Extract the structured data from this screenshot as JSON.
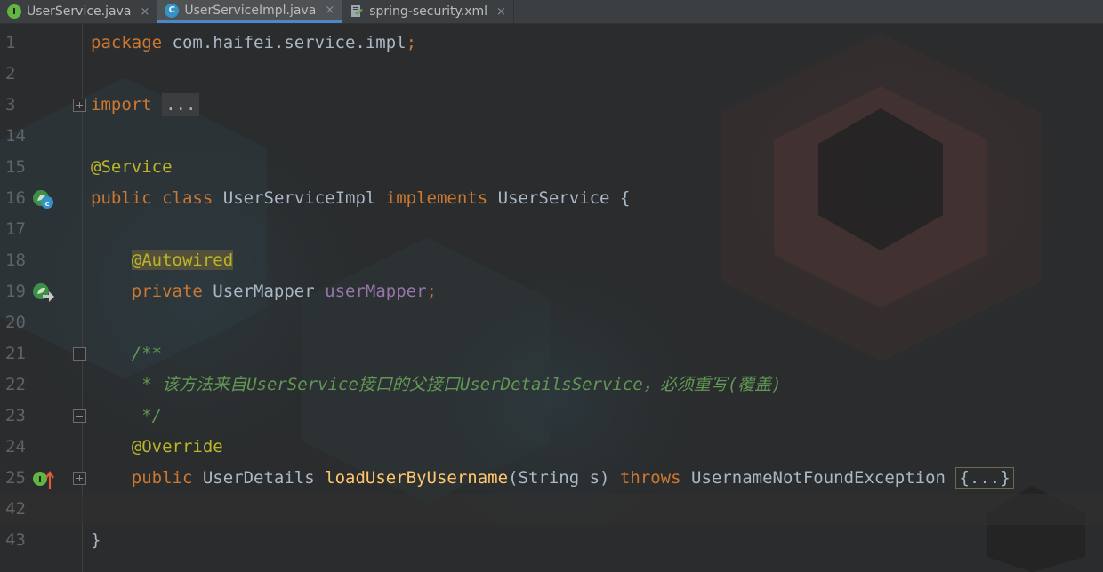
{
  "tabs": [
    {
      "label": "UserService.java",
      "icon": "interface-icon",
      "icon_letter": "I",
      "active": false
    },
    {
      "label": "UserServiceImpl.java",
      "icon": "class-icon",
      "icon_letter": "C",
      "active": true
    },
    {
      "label": "spring-security.xml",
      "icon": "xml-file-icon",
      "icon_letter": "",
      "active": false
    }
  ],
  "close_glyph": "×",
  "editor": {
    "line_numbers": [
      "1",
      "2",
      "3",
      "14",
      "15",
      "16",
      "17",
      "18",
      "19",
      "20",
      "21",
      "22",
      "23",
      "24",
      "25",
      "42",
      "43"
    ],
    "lines": {
      "l1": {
        "kw": "package",
        "rest": " com.haifei.service.impl",
        "semi": ";"
      },
      "l3": {
        "kw": "import",
        "fold": "..."
      },
      "l15": {
        "ann": "@Service"
      },
      "l16": {
        "kw1": "public",
        "kw2": "class",
        "name": "UserServiceImpl",
        "kw3": "implements",
        "iface": "UserService",
        "brace": "{"
      },
      "l18": {
        "ann": "@Autowired"
      },
      "l19": {
        "kw": "private",
        "type": "UserMapper",
        "field": "userMapper",
        "semi": ";"
      },
      "l21": {
        "comment": "/**"
      },
      "l22": {
        "comment": " * 该方法来自UserService接口的父接口UserDetailsService，必须重写(覆盖)"
      },
      "l23": {
        "comment": " */"
      },
      "l24": {
        "ann": "@Override"
      },
      "l25": {
        "kw1": "public",
        "type": "UserDetails",
        "method": "loadUserByUsername",
        "params": "(String s)",
        "kw2": "throws",
        "exc": "UsernameNotFoundException",
        "fold": "{...}"
      },
      "l43": {
        "brace": "}"
      }
    }
  },
  "colors": {
    "keyword": "#cc7832",
    "annotation": "#bbb529",
    "field": "#9876aa",
    "method": "#ffc66d",
    "comment": "#629755",
    "text": "#a9b7c6",
    "background": "#2b2b2b"
  }
}
